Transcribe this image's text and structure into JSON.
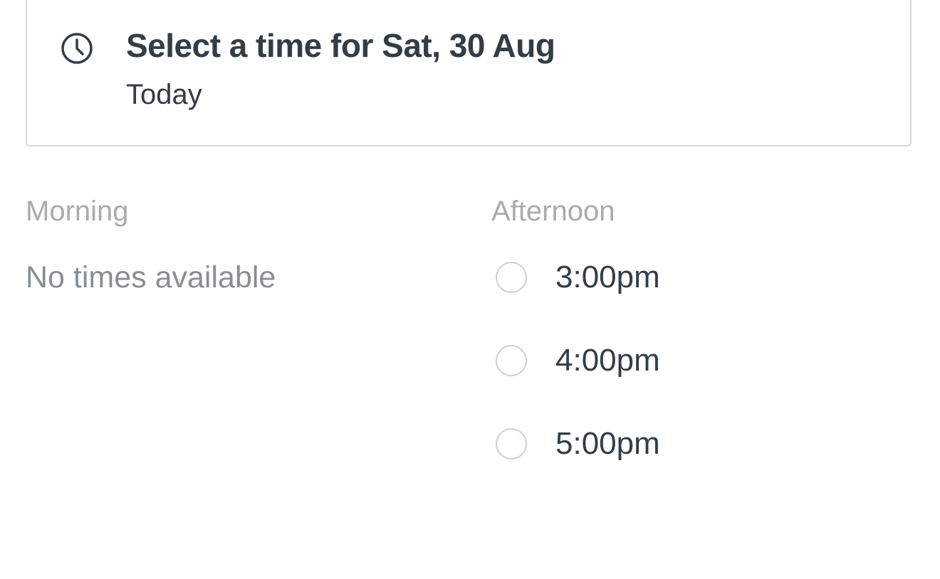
{
  "header": {
    "title": "Select a time for Sat, 30 Aug",
    "subtitle": "Today",
    "icon": "clock-icon"
  },
  "morning": {
    "heading": "Morning",
    "empty_message": "No times available"
  },
  "afternoon": {
    "heading": "Afternoon",
    "slots": [
      {
        "label": "3:00pm",
        "selected": false
      },
      {
        "label": "4:00pm",
        "selected": false
      },
      {
        "label": "5:00pm",
        "selected": false
      }
    ]
  },
  "colors": {
    "text_primary": "#333d47",
    "text_muted": "#a9abad",
    "text_empty": "#8a8e93",
    "border": "#d9d9d9",
    "radio_border": "#d0d0d0"
  }
}
